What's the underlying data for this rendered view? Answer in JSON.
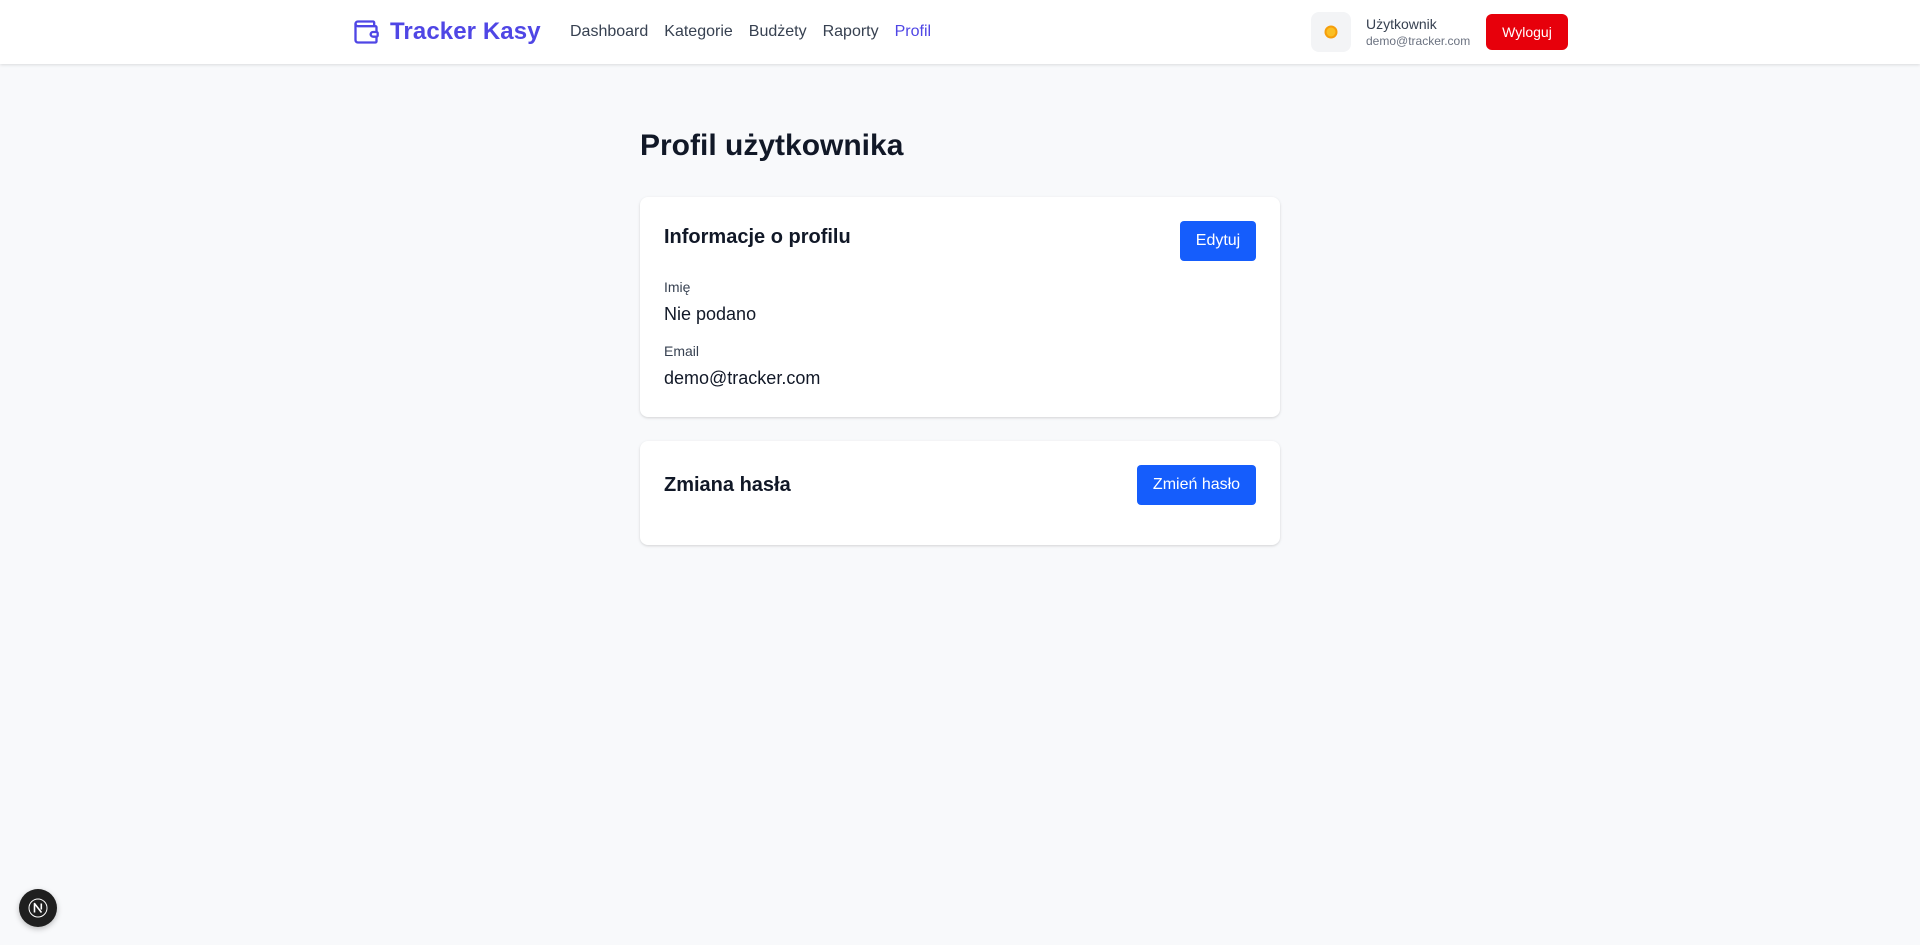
{
  "header": {
    "brand_name": "Tracker Kasy",
    "brand_icon": "wallet-icon",
    "brand_color": "#4f46e5",
    "nav": [
      {
        "label": "Dashboard",
        "active": false
      },
      {
        "label": "Kategorie",
        "active": false
      },
      {
        "label": "Budżety",
        "active": false
      },
      {
        "label": "Raporty",
        "active": false
      },
      {
        "label": "Profil",
        "active": true
      }
    ],
    "theme_toggle_icon": "sun-icon",
    "user": {
      "name": "Użytkownik",
      "email": "demo@tracker.com"
    },
    "logout_label": "Wyloguj",
    "logout_color": "#e7000b"
  },
  "main": {
    "page_title": "Profil użytkownika",
    "profile_card": {
      "title": "Informacje o profilu",
      "edit_label": "Edytuj",
      "fields": {
        "name_label": "Imię",
        "name_value": "Nie podano",
        "email_label": "Email",
        "email_value": "demo@tracker.com"
      }
    },
    "password_card": {
      "title": "Zmiana hasła",
      "change_label": "Zmień hasło"
    },
    "primary_button_color": "#155dfc"
  },
  "dev_badge": {
    "letter": "N",
    "icon": "nextjs-logo-icon"
  }
}
